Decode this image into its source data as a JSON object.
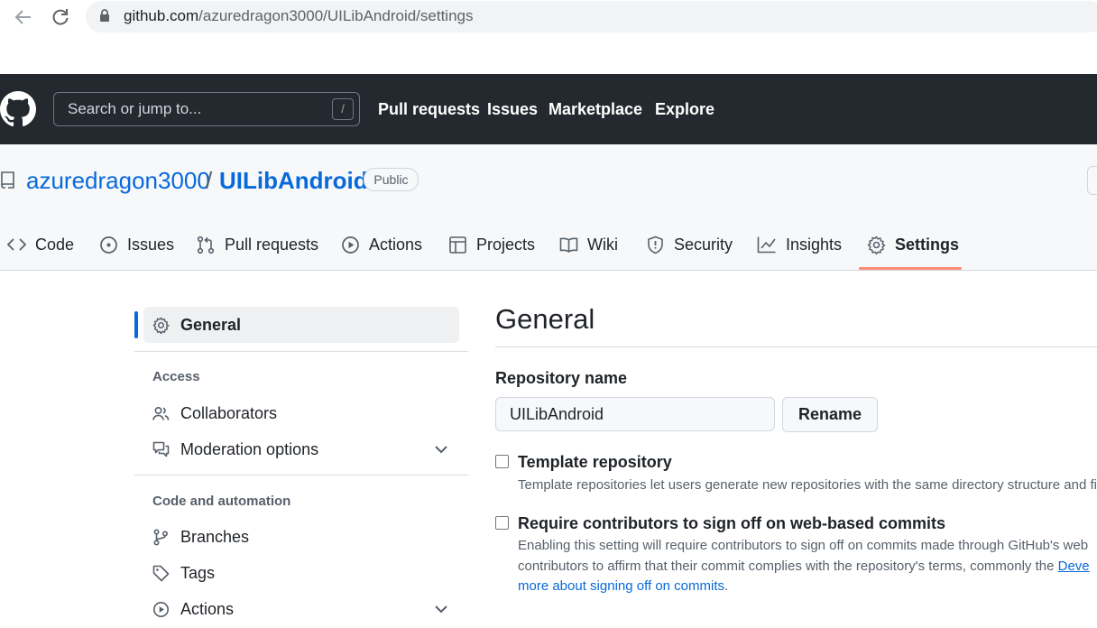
{
  "browser": {
    "url_host": "github.com",
    "url_path": "/azuredragon3000/UILibAndroid/settings"
  },
  "header": {
    "search_placeholder": "Search or jump to...",
    "search_shortcut": "/",
    "nav": [
      "Pull requests",
      "Issues",
      "Marketplace",
      "Explore"
    ]
  },
  "repo": {
    "owner": "azuredragon3000",
    "separator": "/",
    "name": "UILibAndroid",
    "visibility": "Public"
  },
  "tabs": [
    {
      "label": "Code",
      "icon": "code-icon"
    },
    {
      "label": "Issues",
      "icon": "issue-icon"
    },
    {
      "label": "Pull requests",
      "icon": "pull-request-icon"
    },
    {
      "label": "Actions",
      "icon": "play-icon"
    },
    {
      "label": "Projects",
      "icon": "table-icon"
    },
    {
      "label": "Wiki",
      "icon": "book-icon"
    },
    {
      "label": "Security",
      "icon": "shield-icon"
    },
    {
      "label": "Insights",
      "icon": "graph-icon"
    },
    {
      "label": "Settings",
      "icon": "gear-icon",
      "selected": true
    }
  ],
  "sidebar": {
    "general": "General",
    "access_heading": "Access",
    "collaborators": "Collaborators",
    "moderation": "Moderation options",
    "code_heading": "Code and automation",
    "branches": "Branches",
    "tags": "Tags",
    "actions": "Actions"
  },
  "main": {
    "title": "General",
    "repo_name_label": "Repository name",
    "repo_name_value": "UILibAndroid",
    "rename_label": "Rename",
    "template": {
      "title": "Template repository",
      "checked": false,
      "desc": "Template repositories let users generate new repositories with the same directory structure and fil"
    },
    "signoff": {
      "title": "Require contributors to sign off on web-based commits",
      "checked": false,
      "desc1": "Enabling this setting will require contributors to sign off on commits made through GitHub's web",
      "desc2_prefix": "contributors to affirm that their commit complies with the repository's terms, commonly the ",
      "desc2_link": "Deve",
      "desc3_link": "more about signing off on commits",
      "desc3_suffix": "."
    }
  },
  "colors": {
    "header_bg": "#24292f",
    "link": "#0969da",
    "tab_underline": "#fd8c73",
    "active_bar": "#0969da"
  }
}
